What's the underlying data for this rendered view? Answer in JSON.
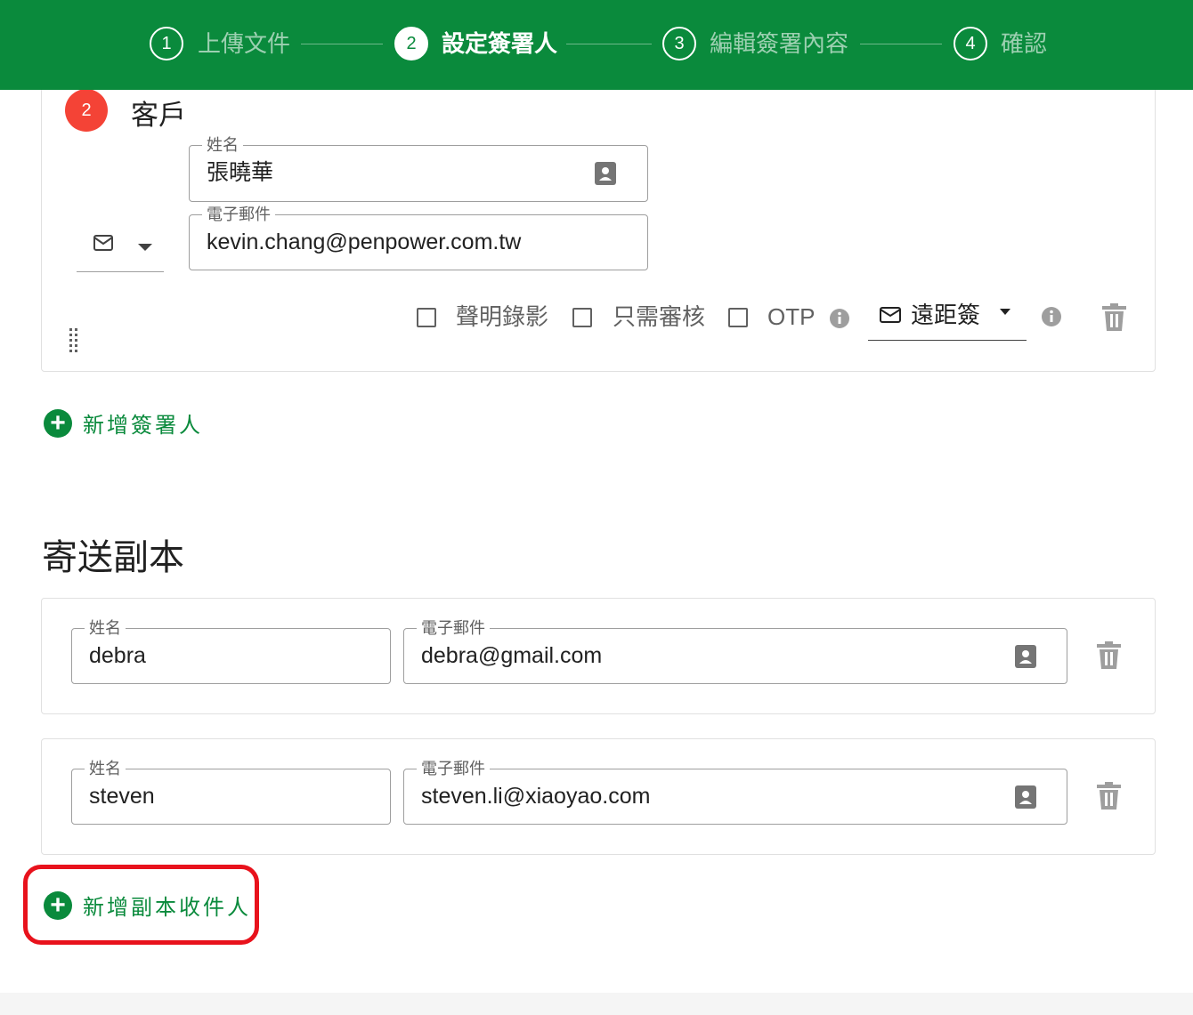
{
  "stepper": {
    "steps": [
      {
        "number": "1",
        "label": "上傳文件"
      },
      {
        "number": "2",
        "label": "設定簽署人"
      },
      {
        "number": "3",
        "label": "編輯簽署內容"
      },
      {
        "number": "4",
        "label": "確認"
      }
    ],
    "active_step": 2
  },
  "signer": {
    "order": "2",
    "role": "客戶",
    "name_label": "姓名",
    "name_value": "張曉華",
    "email_label": "電子郵件",
    "email_value": "kevin.chang@penpower.com.tw",
    "notify_method_icon": "mail-icon",
    "options": [
      {
        "label": "聲明錄影",
        "checked": false
      },
      {
        "label": "只需審核",
        "checked": false
      },
      {
        "label": "OTP",
        "checked": false
      }
    ],
    "sign_type": "遠距簽"
  },
  "add_signer_label": "新增簽署人",
  "cc": {
    "title": "寄送副本",
    "name_label": "姓名",
    "email_label": "電子郵件",
    "recipients": [
      {
        "name": "debra",
        "email": "debra@gmail.com"
      },
      {
        "name": "steven",
        "email": "steven.li@xiaoyao.com"
      }
    ],
    "add_label": "新增副本收件人"
  },
  "colors": {
    "brand_green": "#0a8a3c",
    "badge_red": "#f44336",
    "highlight_red": "#e8121c"
  }
}
